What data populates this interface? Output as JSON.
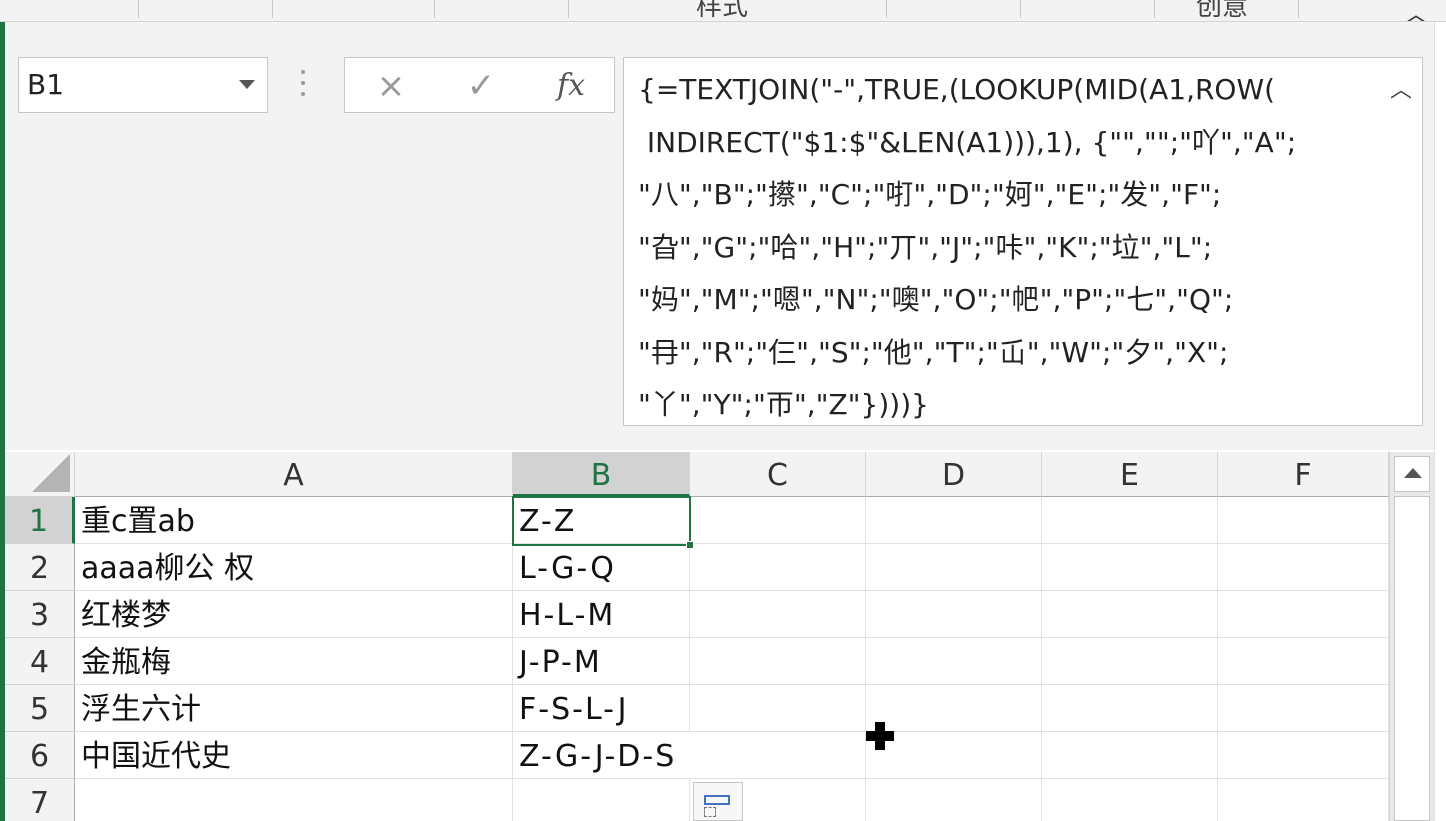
{
  "ribbon": {
    "group_styles": "样式",
    "group_creative": "创意",
    "collapse_icon": "chevron-up-icon"
  },
  "formula_bar": {
    "name_box": "B1",
    "cancel_icon": "×",
    "enter_icon": "✓",
    "fx_label": "fx",
    "formula": "{=TEXTJOIN(\"-\",TRUE,(LOOKUP(MID(A1,ROW(\n INDIRECT(\"$1:$\"&LEN(A1))),1), {\"\",\"\";\"吖\",\"A\";\n\"八\",\"B\";\"攃\",\"C\";\"咑\",\"D\";\"妸\",\"E\";\"发\",\"F\";\n\"旮\",\"G\";\"哈\",\"H\";\"丌\",\"J\";\"咔\",\"K\";\"垃\",\"L\";\n\"妈\",\"M\";\"嗯\",\"N\";\"噢\",\"O\";\"帊\",\"P\";\"七\",\"Q\";\n\"冄\",\"R\";\"仨\",\"S\";\"他\",\"T\";\"屲\",\"W\";\"夕\",\"X\";\n\"丫\",\"Y\";\"帀\",\"Z\"})))}"
  },
  "sheet": {
    "columns": [
      "A",
      "B",
      "C",
      "D",
      "E",
      "F"
    ],
    "rows": [
      "1",
      "2",
      "3",
      "4",
      "5",
      "6",
      "7"
    ],
    "col_a": [
      " 重c置ab",
      "aaaa柳公  权",
      "红楼梦",
      "金瓶梅",
      "浮生六计",
      "中国近代史",
      ""
    ],
    "col_b": [
      "Z-Z",
      "L-G-Q",
      "H-L-M",
      "J-P-M",
      "F-S-L-J",
      "Z-G-J-D-S",
      ""
    ],
    "active_cell": "B1"
  }
}
